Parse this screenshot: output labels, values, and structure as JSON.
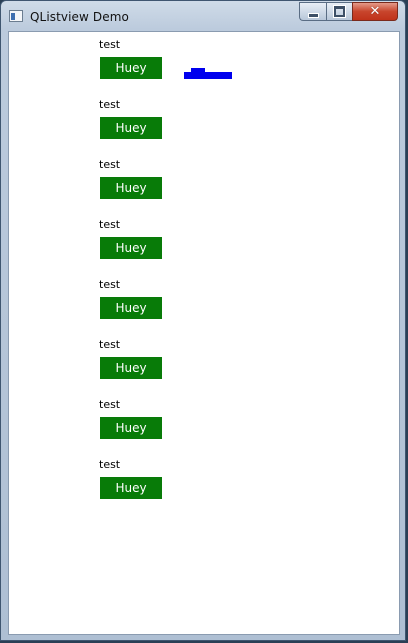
{
  "window": {
    "title": "QListview Demo",
    "controls": {
      "minimize": "minimize",
      "maximize": "maximize",
      "close": "close"
    }
  },
  "list": {
    "items": [
      {
        "label": "test",
        "button": "Huey"
      },
      {
        "label": "test",
        "button": "Huey"
      },
      {
        "label": "test",
        "button": "Huey"
      },
      {
        "label": "test",
        "button": "Huey"
      },
      {
        "label": "test",
        "button": "Huey"
      },
      {
        "label": "test",
        "button": "Huey"
      },
      {
        "label": "test",
        "button": "Huey"
      },
      {
        "label": "test",
        "button": "Huey"
      }
    ]
  },
  "colors": {
    "button_bg": "#087b08",
    "overlay_widget": "#0000ee"
  }
}
